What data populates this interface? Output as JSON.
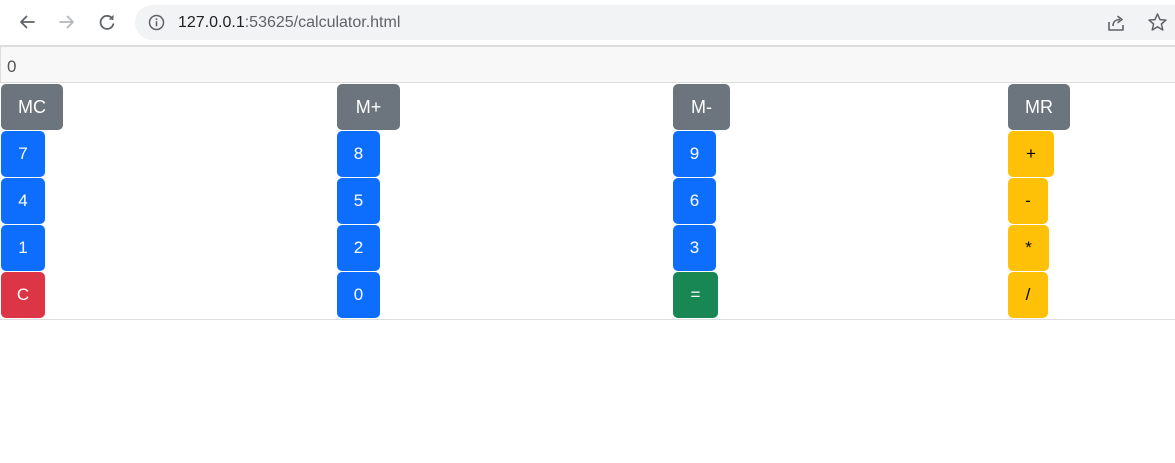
{
  "browser": {
    "url_host": "127.0.0.1",
    "url_rest": ":53625/calculator.html"
  },
  "calculator": {
    "display": "0",
    "memory": {
      "mc": "MC",
      "mplus": "M+",
      "mminus": "M-",
      "mr": "MR"
    },
    "keys": {
      "k7": "7",
      "k8": "8",
      "k9": "9",
      "plus": "+",
      "k4": "4",
      "k5": "5",
      "k6": "6",
      "minus": "-",
      "k1": "1",
      "k2": "2",
      "k3": "3",
      "multiply": "*",
      "clear": "C",
      "k0": "0",
      "equals": "=",
      "divide": "/"
    }
  },
  "colors": {
    "memory_button": "#6c757d",
    "digit_button": "#0d6efd",
    "clear_button": "#dc3545",
    "equals_button": "#198754",
    "operator_button": "#ffc107"
  }
}
